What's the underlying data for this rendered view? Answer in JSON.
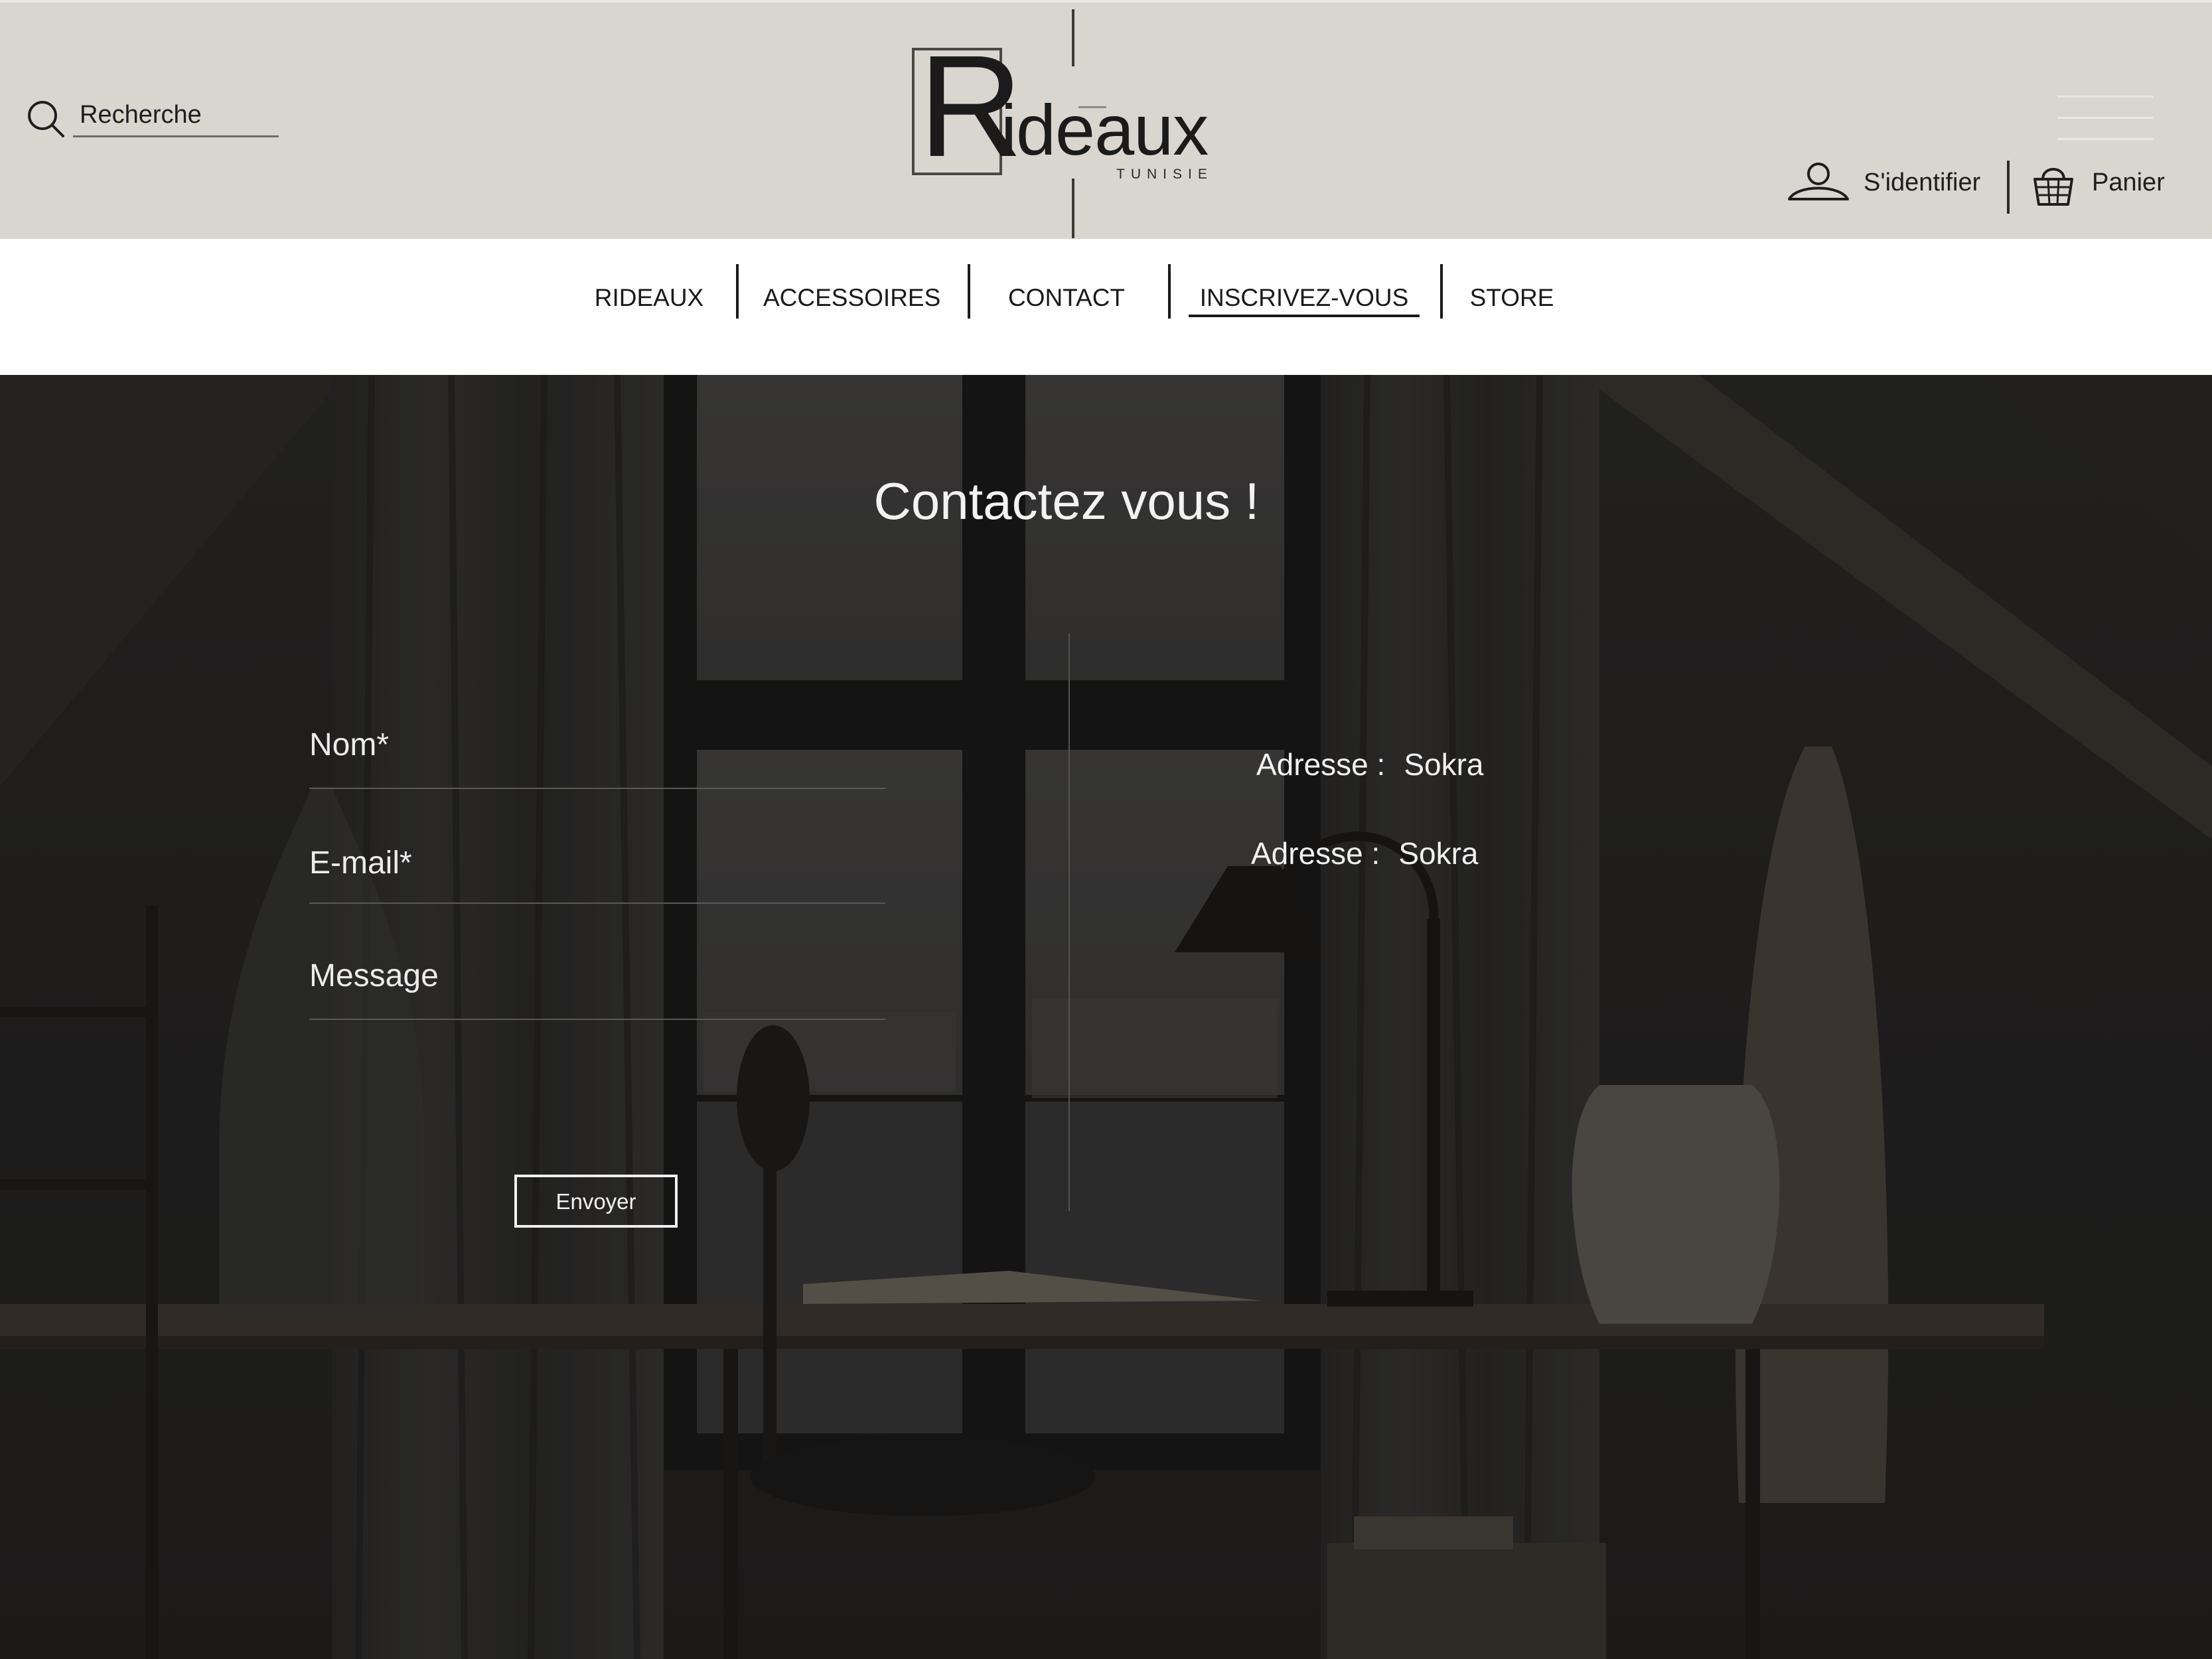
{
  "header": {
    "search_label": "Recherche",
    "logo": {
      "initial": "R",
      "rest": "ideaux",
      "tagline": "TUNISIE"
    },
    "signin_label": "S'identifier",
    "cart_label": "Panier"
  },
  "nav": {
    "items": [
      {
        "label": "RIDEAUX"
      },
      {
        "label": "ACCESSOIRES"
      },
      {
        "label": "CONTACT"
      },
      {
        "label": "INSCRIVEZ-VOUS",
        "active": true
      },
      {
        "label": "STORE"
      }
    ]
  },
  "contact": {
    "title": "Contactez vous !",
    "fields": {
      "name_label": "Nom*",
      "email_label": "E-mail*",
      "message_label": "Message"
    },
    "send_label": "Envoyer",
    "info": [
      {
        "label": "Adresse :",
        "value": "Sokra"
      },
      {
        "label": "Adresse :",
        "value": "Sokra"
      }
    ]
  },
  "colors": {
    "header_bg": "#d9d5cf",
    "nav_bg": "#ffffff",
    "hero_overlay": "#2e2d2c",
    "text_light": "#f2f2f2",
    "text_dark": "#1a1a1a"
  },
  "icons": {
    "search": "search-icon",
    "user": "user-icon",
    "cart": "basket-icon",
    "menu": "hamburger-icon"
  }
}
